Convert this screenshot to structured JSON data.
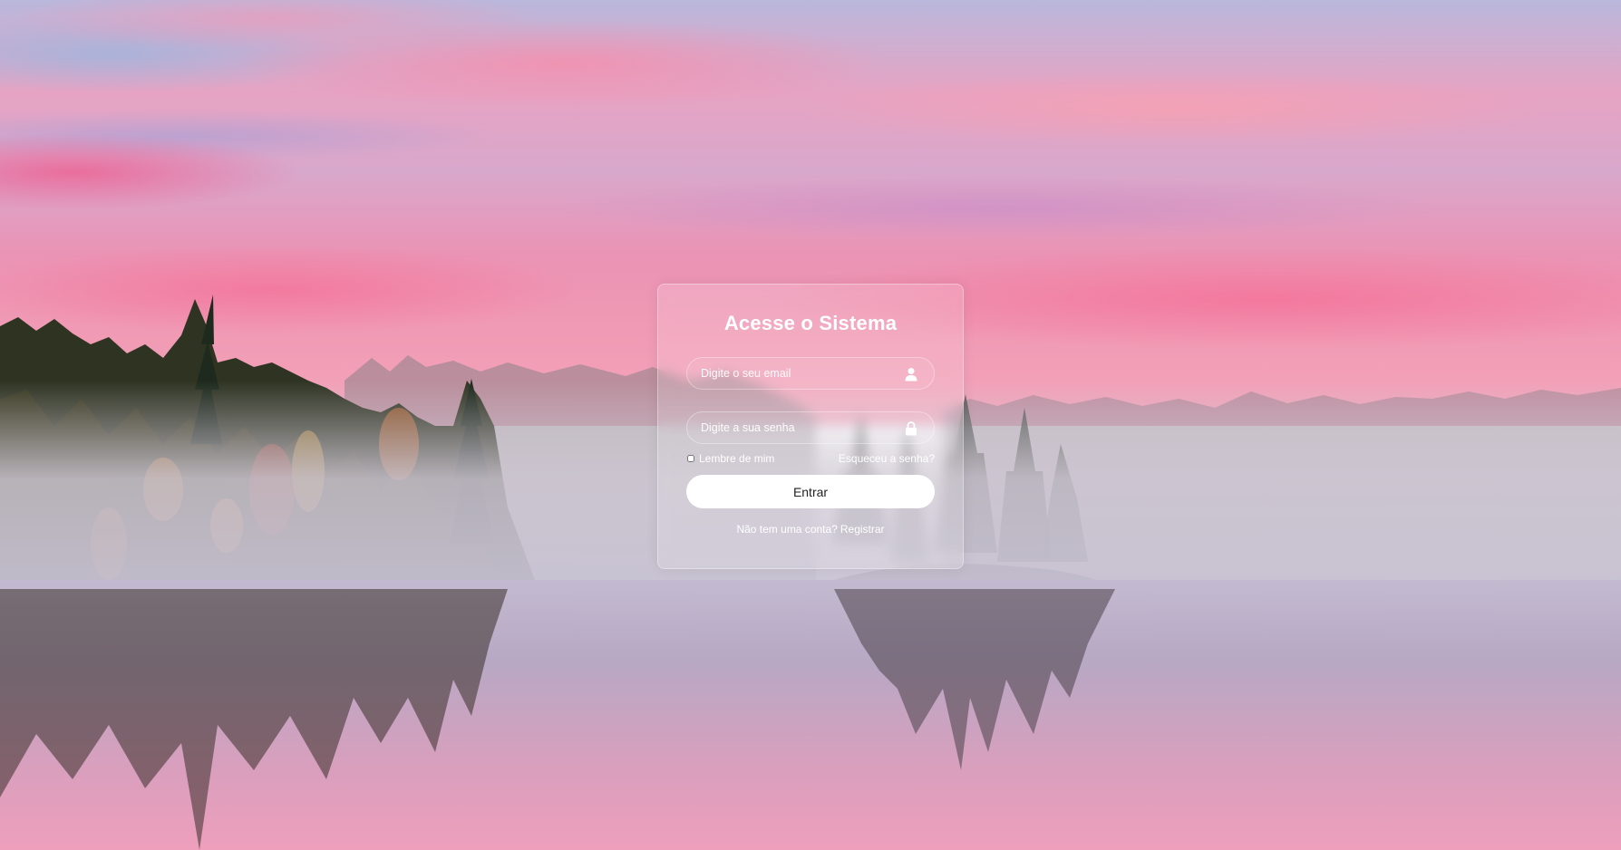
{
  "login": {
    "title": "Acesse o Sistema",
    "email_placeholder": "Digite o seu email",
    "password_placeholder": "Digite a sua senha",
    "remember_label": "Lembre de mim",
    "forgot_label": "Esqueceu a senha?",
    "submit_label": "Entrar",
    "no_account_text": "Não tem uma conta?",
    "register_label": "Registrar"
  },
  "icons": {
    "email": "user-icon",
    "password": "lock-icon"
  },
  "colors": {
    "card_text": "#ffffff",
    "button_bg": "#ffffff",
    "button_text": "#222222"
  }
}
